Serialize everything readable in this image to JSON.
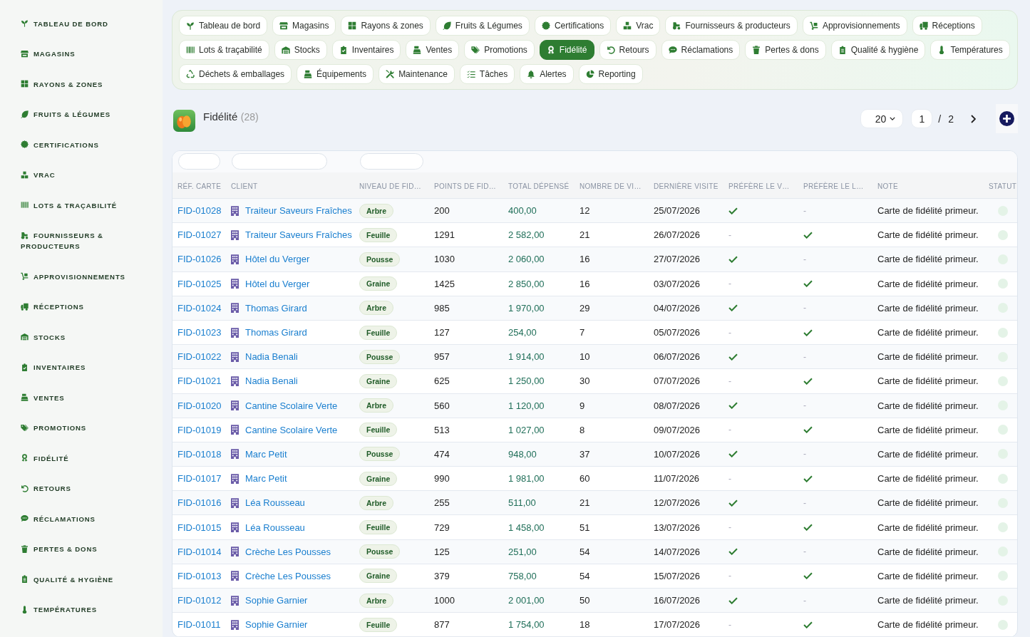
{
  "sidebar": {
    "items": [
      {
        "label": "TABLEAU DE BORD"
      },
      {
        "label": "MAGASINS"
      },
      {
        "label": "RAYONS & ZONES"
      },
      {
        "label": "FRUITS & LÉGUMES"
      },
      {
        "label": "CERTIFICATIONS"
      },
      {
        "label": "VRAC"
      },
      {
        "label": "LOTS & TRAÇABILITÉ"
      },
      {
        "label": "FOURNISSEURS & PRODUCTEURS"
      },
      {
        "label": "APPROVISIONNEMENTS"
      },
      {
        "label": "RÉCEPTIONS"
      },
      {
        "label": "STOCKS"
      },
      {
        "label": "INVENTAIRES"
      },
      {
        "label": "VENTES"
      },
      {
        "label": "PROMOTIONS"
      },
      {
        "label": "FIDÉLITÉ"
      },
      {
        "label": "RETOURS"
      },
      {
        "label": "RÉCLAMATIONS"
      },
      {
        "label": "PERTES & DONS"
      },
      {
        "label": "QUALITÉ & HYGIÈNE"
      },
      {
        "label": "TEMPÉRATURES"
      }
    ]
  },
  "nav": {
    "tabs": [
      {
        "label": "Tableau de bord",
        "selected": false
      },
      {
        "label": "Magasins",
        "selected": false
      },
      {
        "label": "Rayons & zones",
        "selected": false
      },
      {
        "label": "Fruits & Légumes",
        "selected": false
      },
      {
        "label": "Certifications",
        "selected": false
      },
      {
        "label": "Vrac",
        "selected": false
      },
      {
        "label": "Fournisseurs & producteurs",
        "selected": false
      },
      {
        "label": "Approvisionnements",
        "selected": false
      },
      {
        "label": "Réceptions",
        "selected": false
      },
      {
        "label": "Lots & traçabilité",
        "selected": false
      },
      {
        "label": "Stocks",
        "selected": false
      },
      {
        "label": "Inventaires",
        "selected": false
      },
      {
        "label": "Ventes",
        "selected": false
      },
      {
        "label": "Promotions",
        "selected": false
      },
      {
        "label": "Fidélité",
        "selected": true
      },
      {
        "label": "Retours",
        "selected": false
      },
      {
        "label": "Réclamations",
        "selected": false
      },
      {
        "label": "Pertes & dons",
        "selected": false
      },
      {
        "label": "Qualité & hygiène",
        "selected": false
      },
      {
        "label": "Températures",
        "selected": false
      },
      {
        "label": "Déchets & emballages",
        "selected": false
      },
      {
        "label": "Équipements",
        "selected": false
      },
      {
        "label": "Maintenance",
        "selected": false
      },
      {
        "label": "Tâches",
        "selected": false
      },
      {
        "label": "Alertes",
        "selected": false
      },
      {
        "label": "Reporting",
        "selected": false
      }
    ]
  },
  "header": {
    "title": "Fidélité",
    "count": "(28)",
    "page_size": "20",
    "page": "1",
    "separator": "/",
    "page_count": "2"
  },
  "table": {
    "empty_mark": "-",
    "columns": [
      {
        "label": "RÉF. CARTE",
        "filter": true
      },
      {
        "label": "CLIENT",
        "filter": true
      },
      {
        "label": "NIVEAU DE FID…",
        "filter": true
      },
      {
        "label": "POINTS DE FID…",
        "filter": false
      },
      {
        "label": "TOTAL DÉPENSÉ",
        "filter": false
      },
      {
        "label": "NOMBRE DE VI…",
        "filter": false
      },
      {
        "label": "DERNIÈRE VISITE",
        "filter": false
      },
      {
        "label": "PRÉFÈRE LE V…",
        "filter": false
      },
      {
        "label": "PRÉFÈRE LE L…",
        "filter": false
      },
      {
        "label": "NOTE",
        "filter": false
      },
      {
        "label": "STATUT",
        "filter": false
      }
    ],
    "rows": [
      {
        "ref": "FID-01028",
        "client": "Traiteur Saveurs Fraîches",
        "niveau": "Arbre",
        "points": "200",
        "total_depense": "400,00",
        "nombre": "12",
        "derniere_visite": "25/07/2026",
        "prefere_v": true,
        "prefere_l": false,
        "note": "Carte de fidélité primeur."
      },
      {
        "ref": "FID-01027",
        "client": "Traiteur Saveurs Fraîches",
        "niveau": "Feuille",
        "points": "1291",
        "total_depense": "2 582,00",
        "nombre": "21",
        "derniere_visite": "26/07/2026",
        "prefere_v": false,
        "prefere_l": true,
        "note": "Carte de fidélité primeur."
      },
      {
        "ref": "FID-01026",
        "client": "Hôtel du Verger",
        "niveau": "Pousse",
        "points": "1030",
        "total_depense": "2 060,00",
        "nombre": "16",
        "derniere_visite": "27/07/2026",
        "prefere_v": true,
        "prefere_l": false,
        "note": "Carte de fidélité primeur."
      },
      {
        "ref": "FID-01025",
        "client": "Hôtel du Verger",
        "niveau": "Graine",
        "points": "1425",
        "total_depense": "2 850,00",
        "nombre": "16",
        "derniere_visite": "03/07/2026",
        "prefere_v": false,
        "prefere_l": true,
        "note": "Carte de fidélité primeur."
      },
      {
        "ref": "FID-01024",
        "client": "Thomas Girard",
        "niveau": "Arbre",
        "points": "985",
        "total_depense": "1 970,00",
        "nombre": "29",
        "derniere_visite": "04/07/2026",
        "prefere_v": true,
        "prefere_l": false,
        "note": "Carte de fidélité primeur."
      },
      {
        "ref": "FID-01023",
        "client": "Thomas Girard",
        "niveau": "Feuille",
        "points": "127",
        "total_depense": "254,00",
        "nombre": "7",
        "derniere_visite": "05/07/2026",
        "prefere_v": false,
        "prefere_l": true,
        "note": "Carte de fidélité primeur."
      },
      {
        "ref": "FID-01022",
        "client": "Nadia Benali",
        "niveau": "Pousse",
        "points": "957",
        "total_depense": "1 914,00",
        "nombre": "10",
        "derniere_visite": "06/07/2026",
        "prefere_v": true,
        "prefere_l": false,
        "note": "Carte de fidélité primeur."
      },
      {
        "ref": "FID-01021",
        "client": "Nadia Benali",
        "niveau": "Graine",
        "points": "625",
        "total_depense": "1 250,00",
        "nombre": "30",
        "derniere_visite": "07/07/2026",
        "prefere_v": false,
        "prefere_l": true,
        "note": "Carte de fidélité primeur."
      },
      {
        "ref": "FID-01020",
        "client": "Cantine Scolaire Verte",
        "niveau": "Arbre",
        "points": "560",
        "total_depense": "1 120,00",
        "nombre": "9",
        "derniere_visite": "08/07/2026",
        "prefere_v": true,
        "prefere_l": false,
        "note": "Carte de fidélité primeur."
      },
      {
        "ref": "FID-01019",
        "client": "Cantine Scolaire Verte",
        "niveau": "Feuille",
        "points": "513",
        "total_depense": "1 027,00",
        "nombre": "8",
        "derniere_visite": "09/07/2026",
        "prefere_v": false,
        "prefere_l": true,
        "note": "Carte de fidélité primeur."
      },
      {
        "ref": "FID-01018",
        "client": "Marc Petit",
        "niveau": "Pousse",
        "points": "474",
        "total_depense": "948,00",
        "nombre": "37",
        "derniere_visite": "10/07/2026",
        "prefere_v": true,
        "prefere_l": false,
        "note": "Carte de fidélité primeur."
      },
      {
        "ref": "FID-01017",
        "client": "Marc Petit",
        "niveau": "Graine",
        "points": "990",
        "total_depense": "1 981,00",
        "nombre": "60",
        "derniere_visite": "11/07/2026",
        "prefere_v": false,
        "prefere_l": true,
        "note": "Carte de fidélité primeur."
      },
      {
        "ref": "FID-01016",
        "client": "Léa Rousseau",
        "niveau": "Arbre",
        "points": "255",
        "total_depense": "511,00",
        "nombre": "21",
        "derniere_visite": "12/07/2026",
        "prefere_v": true,
        "prefere_l": false,
        "note": "Carte de fidélité primeur."
      },
      {
        "ref": "FID-01015",
        "client": "Léa Rousseau",
        "niveau": "Feuille",
        "points": "729",
        "total_depense": "1 458,00",
        "nombre": "51",
        "derniere_visite": "13/07/2026",
        "prefere_v": false,
        "prefere_l": true,
        "note": "Carte de fidélité primeur."
      },
      {
        "ref": "FID-01014",
        "client": "Crèche Les Pousses",
        "niveau": "Pousse",
        "points": "125",
        "total_depense": "251,00",
        "nombre": "54",
        "derniere_visite": "14/07/2026",
        "prefere_v": true,
        "prefere_l": false,
        "note": "Carte de fidélité primeur."
      },
      {
        "ref": "FID-01013",
        "client": "Crèche Les Pousses",
        "niveau": "Graine",
        "points": "379",
        "total_depense": "758,00",
        "nombre": "54",
        "derniere_visite": "15/07/2026",
        "prefere_v": false,
        "prefere_l": true,
        "note": "Carte de fidélité primeur."
      },
      {
        "ref": "FID-01012",
        "client": "Sophie Garnier",
        "niveau": "Arbre",
        "points": "1000",
        "total_depense": "2 001,00",
        "nombre": "50",
        "derniere_visite": "16/07/2026",
        "prefere_v": true,
        "prefere_l": false,
        "note": "Carte de fidélité primeur."
      },
      {
        "ref": "FID-01011",
        "client": "Sophie Garnier",
        "niveau": "Feuille",
        "points": "877",
        "total_depense": "1 754,00",
        "nombre": "18",
        "derniere_visite": "17/07/2026",
        "prefere_v": false,
        "prefere_l": true,
        "note": "Carte de fidélité primeur."
      }
    ]
  }
}
